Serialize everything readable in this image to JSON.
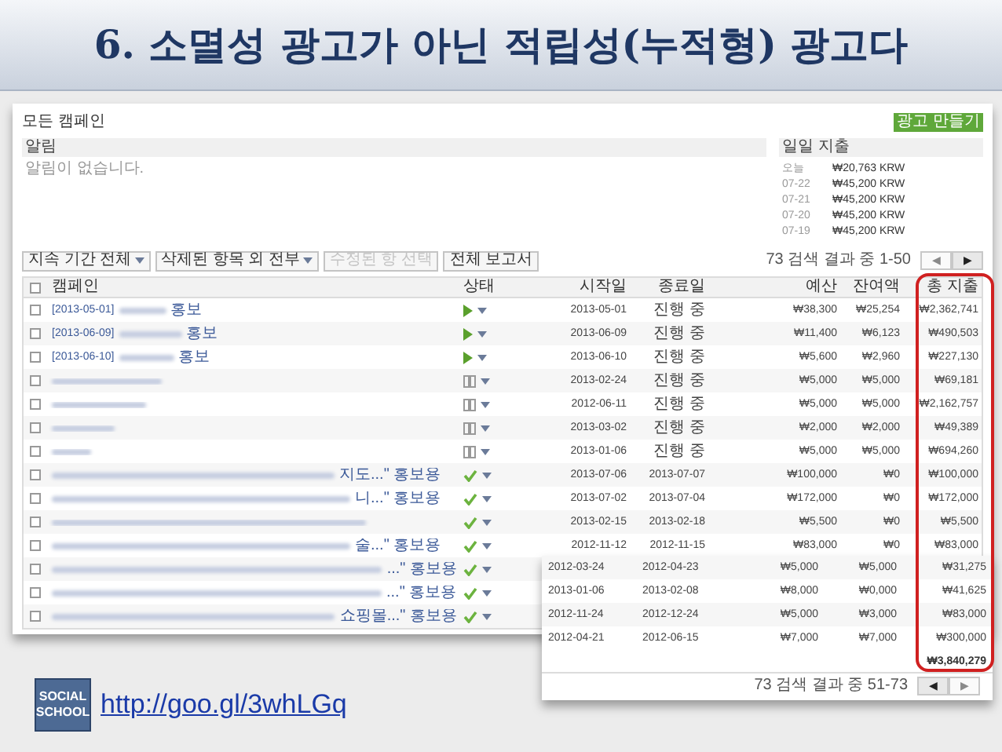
{
  "slide_title": "6. 소멸성 광고가 아닌 적립성(누적형) 광고다",
  "screenshot": {
    "page_title": "모든 캠페인",
    "create_button": "광고 만들기",
    "notifications": {
      "header": "알림",
      "message": "알림이 없습니다."
    },
    "daily_spend": {
      "header": "일일 지출",
      "rows": [
        {
          "date": "오늘",
          "amount": "₩20,763 KRW"
        },
        {
          "date": "07-22",
          "amount": "₩45,200 KRW"
        },
        {
          "date": "07-21",
          "amount": "₩45,200 KRW"
        },
        {
          "date": "07-20",
          "amount": "₩45,200 KRW"
        },
        {
          "date": "07-19",
          "amount": "₩45,200 KRW"
        }
      ]
    },
    "toolbar": [
      {
        "label": "지속 기간 전체",
        "dropdown": true,
        "disabled": false
      },
      {
        "label": "삭제된 항목 외 전부",
        "dropdown": true,
        "disabled": false
      },
      {
        "label": "수정된 항 선택",
        "dropdown": false,
        "disabled": true
      },
      {
        "label": "전체 보고서",
        "dropdown": false,
        "disabled": false
      }
    ],
    "result_count": "73 검색 결과 중 1-50",
    "pager": [
      {
        "label": "◀",
        "disabled": true
      },
      {
        "label": "▶",
        "disabled": false
      }
    ],
    "table": {
      "all_checked": false,
      "columns": [
        "캠페인",
        "상태",
        "시작일",
        "종료일",
        "예산",
        "잔여액",
        "총 지출"
      ],
      "rows": [
        {
          "checked": false,
          "lead": "[2013-05-01]",
          "tail": "홍보",
          "kind": "active",
          "start": "2013-05-01",
          "end": "진행 중",
          "budget": "₩38,300",
          "remaining": "₩25,254",
          "total": "₩2,362,741"
        },
        {
          "checked": false,
          "lead": "[2013-06-09]",
          "tail": "홍보",
          "kind": "active",
          "start": "2013-06-09",
          "end": "진행 중",
          "budget": "₩11,400",
          "remaining": "₩6,123",
          "total": "₩490,503"
        },
        {
          "checked": false,
          "lead": "[2013-06-10]",
          "tail": "홍보",
          "kind": "active",
          "start": "2013-06-10",
          "end": "진행 중",
          "budget": "₩5,600",
          "remaining": "₩2,960",
          "total": "₩227,130"
        },
        {
          "checked": false,
          "kind": "paused",
          "start": "2013-02-24",
          "end": "진행 중",
          "budget": "₩5,000",
          "remaining": "₩5,000",
          "total": "₩69,181"
        },
        {
          "checked": false,
          "kind": "paused",
          "start": "2012-06-11",
          "end": "진행 중",
          "budget": "₩5,000",
          "remaining": "₩5,000",
          "total": "₩2,162,757"
        },
        {
          "checked": false,
          "kind": "paused",
          "start": "2013-03-02",
          "end": "진행 중",
          "budget": "₩2,000",
          "remaining": "₩2,000",
          "total": "₩49,389"
        },
        {
          "checked": false,
          "kind": "paused",
          "start": "2013-01-06",
          "end": "진행 중",
          "budget": "₩5,000",
          "remaining": "₩5,000",
          "total": "₩694,260"
        },
        {
          "checked": false,
          "tail": "지도...\" 홍보용",
          "kind": "completed",
          "start": "2013-07-06",
          "end": "2013-07-07",
          "budget": "₩100,000",
          "remaining": "₩0",
          "total": "₩100,000"
        },
        {
          "checked": false,
          "tail": "니...\" 홍보용",
          "kind": "completed",
          "start": "2013-07-02",
          "end": "2013-07-04",
          "budget": "₩172,000",
          "remaining": "₩0",
          "total": "₩172,000"
        },
        {
          "checked": false,
          "kind": "completed",
          "start": "2013-02-15",
          "end": "2013-02-18",
          "budget": "₩5,500",
          "remaining": "₩0",
          "total": "₩5,500"
        },
        {
          "checked": false,
          "tail": "술...\" 홍보용",
          "kind": "completed",
          "start": "2012-11-12",
          "end": "2012-11-15",
          "budget": "₩83,000",
          "remaining": "₩0",
          "total": "₩83,000"
        },
        {
          "checked": false,
          "tail": "...\" 홍보용",
          "kind": "completed"
        },
        {
          "checked": false,
          "tail": "...\" 홍보용",
          "kind": "completed"
        },
        {
          "checked": false,
          "tail": "쇼핑몰...\" 홍보용",
          "kind": "completed"
        }
      ]
    }
  },
  "overlay": {
    "rows": [
      {
        "start": "2012-03-24",
        "end": "2012-04-23",
        "budget": "₩5,000",
        "remaining": "₩5,000",
        "total": "₩31,275"
      },
      {
        "start": "2013-01-06",
        "end": "2013-02-08",
        "budget": "₩8,000",
        "remaining": "₩0,000",
        "total": "₩41,625"
      },
      {
        "start": "2012-11-24",
        "end": "2012-12-24",
        "budget": "₩5,000",
        "remaining": "₩3,000",
        "total": "₩83,000"
      },
      {
        "start": "2012-04-21",
        "end": "2012-06-15",
        "budget": "₩7,000",
        "remaining": "₩7,000",
        "total": "₩300,000"
      }
    ],
    "grand_total": "₩3,840,279",
    "result_count": "73 검색 결과 중 51-73",
    "pager": [
      {
        "label": "◀",
        "disabled": false
      },
      {
        "label": "▶",
        "disabled": true
      }
    ]
  },
  "footer": {
    "logo": [
      "SOCIAL",
      "SCHOOL"
    ],
    "link": "http://goo.gl/3whLGq"
  }
}
